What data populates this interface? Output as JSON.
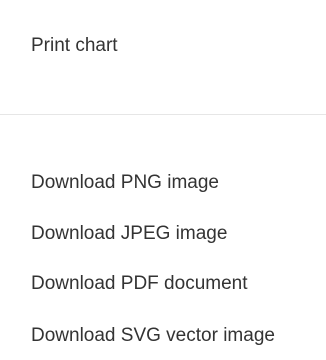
{
  "menu": {
    "items": [
      {
        "label": "Print chart"
      },
      {
        "label": "Download PNG image"
      },
      {
        "label": "Download JPEG image"
      },
      {
        "label": "Download PDF document"
      },
      {
        "label": "Download SVG vector image"
      }
    ]
  }
}
